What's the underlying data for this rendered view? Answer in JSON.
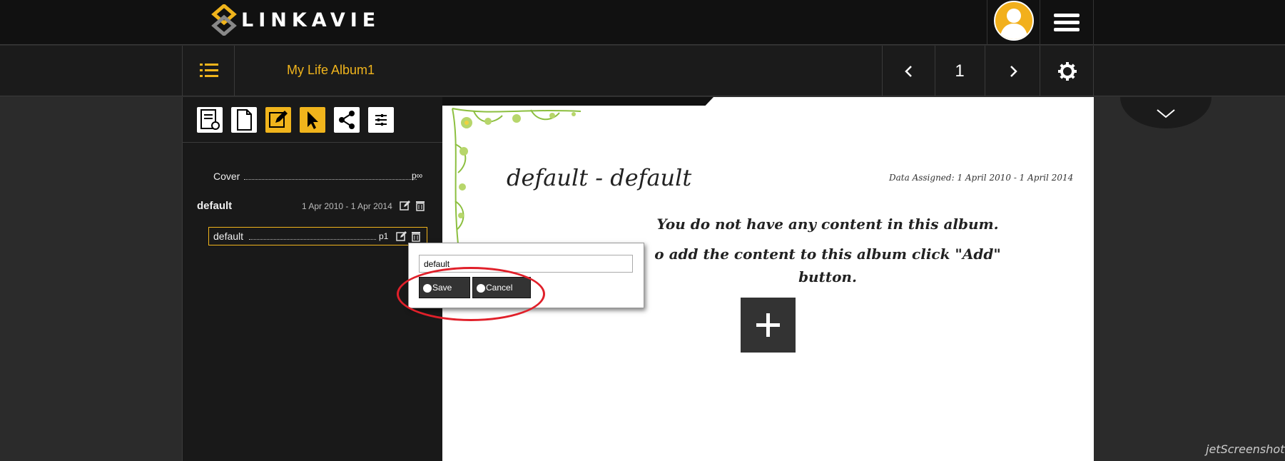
{
  "brand": {
    "name": "LINKAVIE"
  },
  "header": {
    "album_title": "My Life Album1",
    "page_number": "1"
  },
  "toc": {
    "cover": {
      "label": "Cover",
      "page": "p∞"
    },
    "section": {
      "label": "default",
      "date_range": "1 Apr 2010 - 1 Apr 2014"
    },
    "entry": {
      "label": "default",
      "page": "p1"
    }
  },
  "page": {
    "heading": "default - default",
    "date_assigned": "Data Assigned: 1 April 2010 - 1 April 2014",
    "empty_line1": "You do not have any content in this album.",
    "empty_line2": "o add the content to this album click \"Add\"",
    "empty_line3": "button."
  },
  "rename_popup": {
    "input_value": "default",
    "save_label": "Save",
    "cancel_label": "Cancel"
  },
  "watermark": "jetScreenshot",
  "colors": {
    "accent": "#f0b41c",
    "annotation": "#e0202a"
  }
}
